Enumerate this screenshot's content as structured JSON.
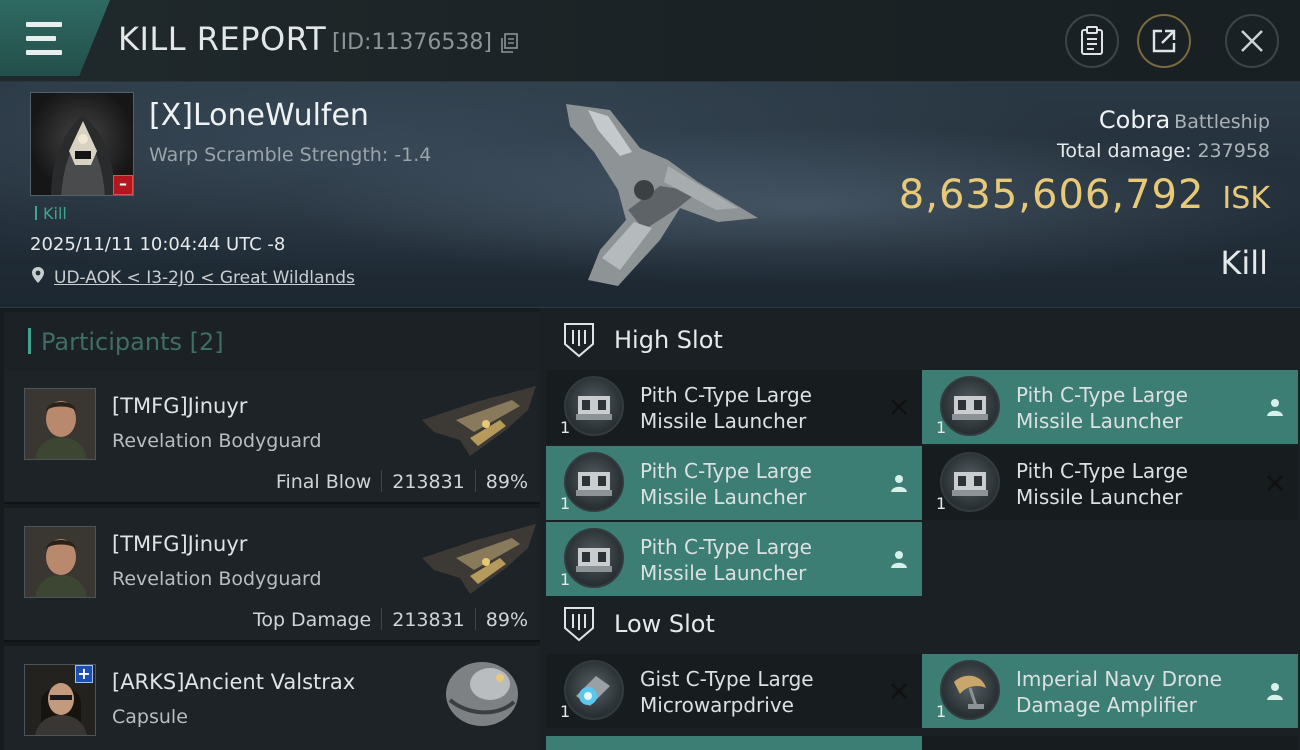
{
  "header": {
    "title": "KILL REPORT",
    "report_id": "[ID:11376538]"
  },
  "victim": {
    "name": "[X]LoneWulfen",
    "stat": "Warp Scramble Strength: -1.4",
    "tag": "Kill",
    "datetime": "2025/11/11 10:04:44 UTC -8",
    "location": "UD-AOK < I3-2J0 < Great Wildlands",
    "ship_name": "Cobra",
    "ship_class": "Battleship",
    "damage_label": "Total damage:",
    "damage_value": "237958",
    "isk_value": "8,635,606,792",
    "isk_unit": "ISK",
    "kill_type": "Kill"
  },
  "participants": {
    "title": "Participants [2]",
    "rows": [
      {
        "name": "[TMFG]Jinuyr",
        "ship": "Revelation Bodyguard",
        "role": "Final Blow",
        "damage": "213831",
        "percent": "89%"
      },
      {
        "name": "[TMFG]Jinuyr",
        "ship": "Revelation Bodyguard",
        "role": "Top Damage",
        "damage": "213831",
        "percent": "89%"
      },
      {
        "name": "[ARKS]Ancient Valstrax",
        "ship": "Capsule"
      }
    ],
    "plus_badge": "+"
  },
  "fittings": {
    "high_slot": {
      "title": "High Slot",
      "modules": [
        {
          "name_l1": "Pith C-Type Large",
          "name_l2": "Missile Launcher",
          "qty": "1",
          "state": "destroyed"
        },
        {
          "name_l1": "Pith C-Type Large",
          "name_l2": "Missile Launcher",
          "qty": "1",
          "state": "dropped"
        },
        {
          "name_l1": "Pith C-Type Large",
          "name_l2": "Missile Launcher",
          "qty": "1",
          "state": "dropped"
        },
        {
          "name_l1": "Pith C-Type Large",
          "name_l2": "Missile Launcher",
          "qty": "1",
          "state": "destroyed"
        },
        {
          "name_l1": "Pith C-Type Large",
          "name_l2": "Missile Launcher",
          "qty": "1",
          "state": "dropped"
        }
      ]
    },
    "low_slot": {
      "title": "Low Slot",
      "modules": [
        {
          "name_l1": "Gist C-Type Large",
          "name_l2": "Microwarpdrive",
          "qty": "1",
          "state": "destroyed"
        },
        {
          "name_l1": "Imperial Navy Drone",
          "name_l2": "Damage Amplifier",
          "qty": "1",
          "state": "dropped"
        }
      ]
    }
  },
  "icons": {
    "menu": "hamburger-icon",
    "copy": "copy-icon",
    "clipboard": "clipboard-icon",
    "share": "share-icon",
    "close": "close-icon",
    "location": "location-pin-icon",
    "slot": "slot-icon",
    "destroyed": "x-icon",
    "dropped": "person-icon"
  },
  "colors": {
    "accent": "#3fa58e",
    "isk": "#e8c978",
    "dropped_bg": "#3c7e73",
    "victim_status": "#b3161c"
  }
}
